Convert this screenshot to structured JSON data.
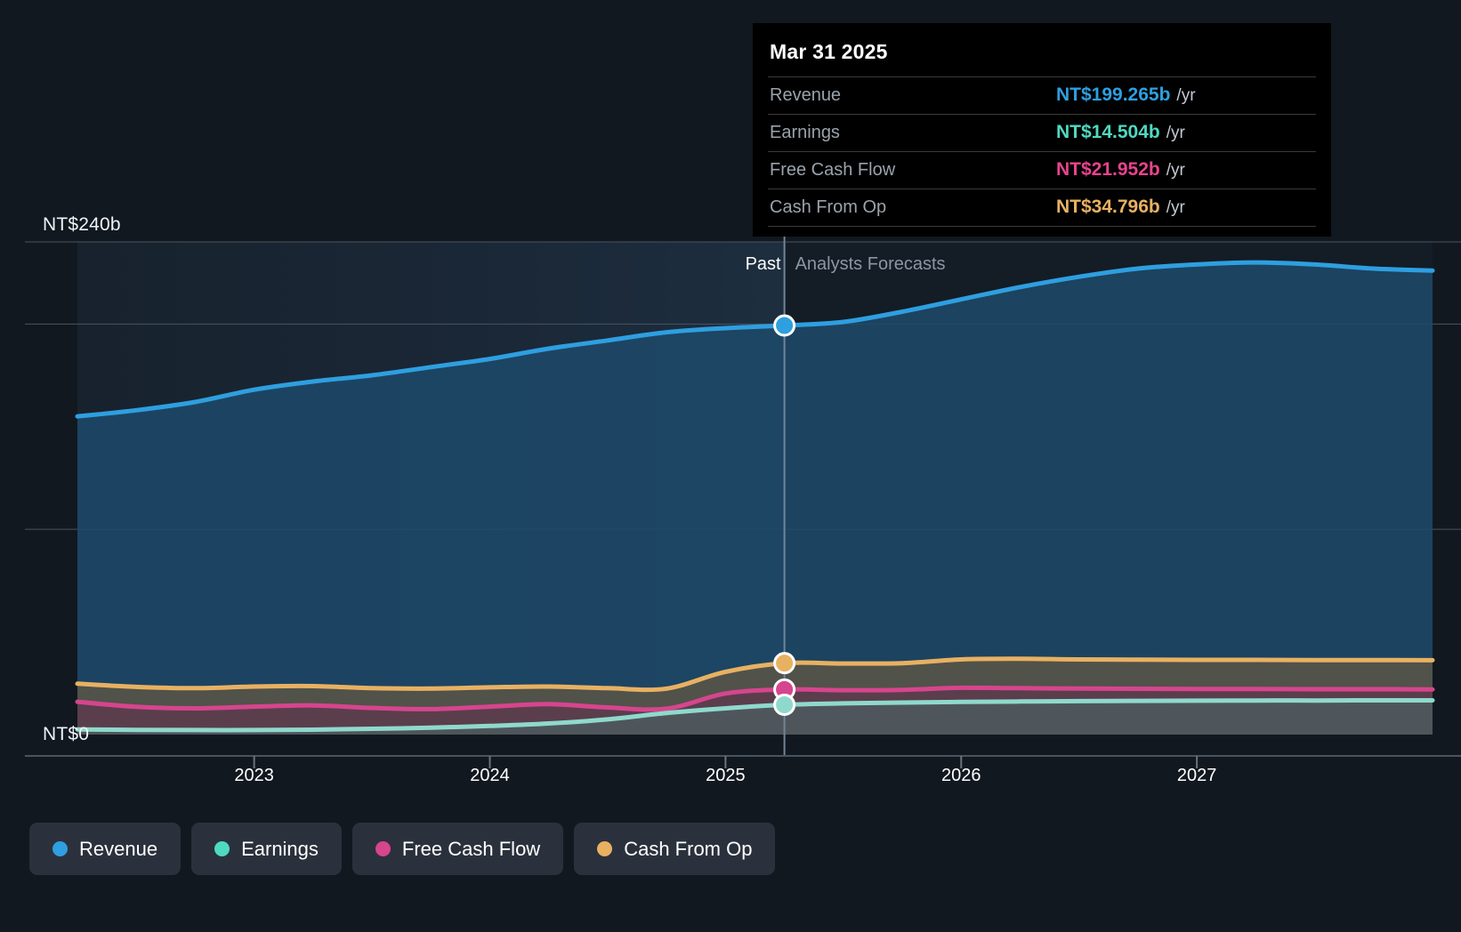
{
  "chart_data": {
    "type": "area",
    "title": "",
    "currency_prefix": "NT$",
    "ylabel": "",
    "xlabel": "",
    "ylim": [
      0,
      240
    ],
    "y_ticks": [
      {
        "label": "NT$240b",
        "value": 240
      },
      {
        "label": "NT$0",
        "value": 0
      }
    ],
    "gridlines": [
      240,
      200,
      100
    ],
    "grid": true,
    "x_ticks": [
      "2023",
      "2024",
      "2025",
      "2026",
      "2027"
    ],
    "x_range": [
      "2022.25",
      "2028.0"
    ],
    "divider": {
      "label_past": "Past",
      "label_forecast": "Analysts Forecasts",
      "x_value": "2025.25"
    },
    "legend_position": "bottom-left",
    "series": [
      {
        "name": "Revenue",
        "color": "#2e9fe0",
        "fill": "#1d4a6b",
        "x": [
          2022.25,
          2022.5,
          2022.75,
          2023.0,
          2023.25,
          2023.5,
          2023.75,
          2024.0,
          2024.25,
          2024.5,
          2024.75,
          2025.0,
          2025.25,
          2025.5,
          2025.75,
          2026.0,
          2026.25,
          2026.5,
          2026.75,
          2027.0,
          2027.25,
          2027.5,
          2027.75,
          2028.0
        ],
        "values": [
          155,
          158,
          162,
          168,
          172,
          175,
          179,
          183,
          188,
          192,
          196,
          198,
          199.265,
          201,
          206,
          212,
          218,
          223,
          227,
          229,
          230,
          229,
          227,
          226
        ]
      },
      {
        "name": "Earnings",
        "color": "#8fd9cc",
        "fill": "#4e5b5e",
        "x": [
          2022.25,
          2022.5,
          2022.75,
          2023.0,
          2023.25,
          2023.5,
          2023.75,
          2024.0,
          2024.25,
          2024.5,
          2024.75,
          2025.0,
          2025.25,
          2025.5,
          2025.75,
          2026.0,
          2026.25,
          2026.5,
          2026.75,
          2027.0,
          2027.25,
          2027.5,
          2027.75,
          2028.0
        ],
        "values": [
          2.5,
          2.3,
          2.2,
          2.2,
          2.4,
          2.8,
          3.4,
          4.2,
          5.4,
          7.4,
          10.5,
          12.8,
          14.504,
          15.2,
          15.6,
          15.9,
          16.1,
          16.3,
          16.4,
          16.5,
          16.6,
          16.6,
          16.7,
          16.7
        ]
      },
      {
        "name": "Free Cash Flow",
        "color": "#d6458d",
        "fill": "#5c3b4c",
        "x": [
          2022.25,
          2022.5,
          2022.75,
          2023.0,
          2023.25,
          2023.5,
          2023.75,
          2024.0,
          2024.25,
          2024.5,
          2024.75,
          2025.0,
          2025.25,
          2025.5,
          2025.75,
          2026.0,
          2026.25,
          2026.5,
          2026.75,
          2027.0,
          2027.25,
          2027.5,
          2027.75,
          2028.0
        ],
        "values": [
          16.0,
          13.5,
          12.8,
          13.6,
          14.2,
          13.0,
          12.4,
          13.6,
          14.8,
          13.2,
          12.6,
          20.0,
          21.952,
          21.6,
          21.8,
          22.8,
          22.6,
          22.4,
          22.3,
          22.2,
          22.2,
          22.1,
          22.1,
          22.0
        ]
      },
      {
        "name": "Cash From Op",
        "color": "#e8b162",
        "fill": "#5a5545",
        "x": [
          2022.25,
          2022.5,
          2022.75,
          2023.0,
          2023.25,
          2023.5,
          2023.75,
          2024.0,
          2024.25,
          2024.5,
          2024.75,
          2025.0,
          2025.25,
          2025.5,
          2025.75,
          2026.0,
          2026.25,
          2026.5,
          2026.75,
          2027.0,
          2027.25,
          2027.5,
          2027.75,
          2028.0
        ],
        "values": [
          24.8,
          23.2,
          22.6,
          23.4,
          23.6,
          22.6,
          22.4,
          23.0,
          23.4,
          22.6,
          22.4,
          30.6,
          34.796,
          34.6,
          34.8,
          36.6,
          36.9,
          36.6,
          36.5,
          36.4,
          36.4,
          36.3,
          36.3,
          36.2
        ]
      }
    ],
    "markers": [
      {
        "series": "Revenue",
        "x": "2025.25",
        "value": 199.265,
        "color": "#2e9fe0"
      },
      {
        "series": "Cash From Op",
        "x": "2025.25",
        "value": 34.796,
        "color": "#e8b162"
      },
      {
        "series": "Free Cash Flow",
        "x": "2025.25",
        "value": 21.952,
        "color": "#d6458d"
      },
      {
        "series": "Earnings",
        "x": "2025.25",
        "value": 14.504,
        "color": "#8fd9cc"
      }
    ]
  },
  "tooltip": {
    "date": "Mar 31 2025",
    "rows": [
      {
        "label": "Revenue",
        "value": "NT$199.265b",
        "unit": "/yr",
        "color": "#2e9fe0"
      },
      {
        "label": "Earnings",
        "value": "NT$14.504b",
        "unit": "/yr",
        "color": "#4fd9c0"
      },
      {
        "label": "Free Cash Flow",
        "value": "NT$21.952b",
        "unit": "/yr",
        "color": "#e8438f"
      },
      {
        "label": "Cash From Op",
        "value": "NT$34.796b",
        "unit": "/yr",
        "color": "#e8b162"
      }
    ]
  },
  "legend": {
    "items": [
      {
        "label": "Revenue",
        "color": "#2e9fe0"
      },
      {
        "label": "Earnings",
        "color": "#4fd9c0"
      },
      {
        "label": "Free Cash Flow",
        "color": "#d6458d"
      },
      {
        "label": "Cash From Op",
        "color": "#e8b162"
      }
    ]
  },
  "axis": {
    "y_top_label": "NT$240b",
    "y_zero_label": "NT$0",
    "x_labels": [
      "2023",
      "2024",
      "2025",
      "2026",
      "2027"
    ]
  },
  "period": {
    "past": "Past",
    "forecast": "Analysts Forecasts"
  }
}
